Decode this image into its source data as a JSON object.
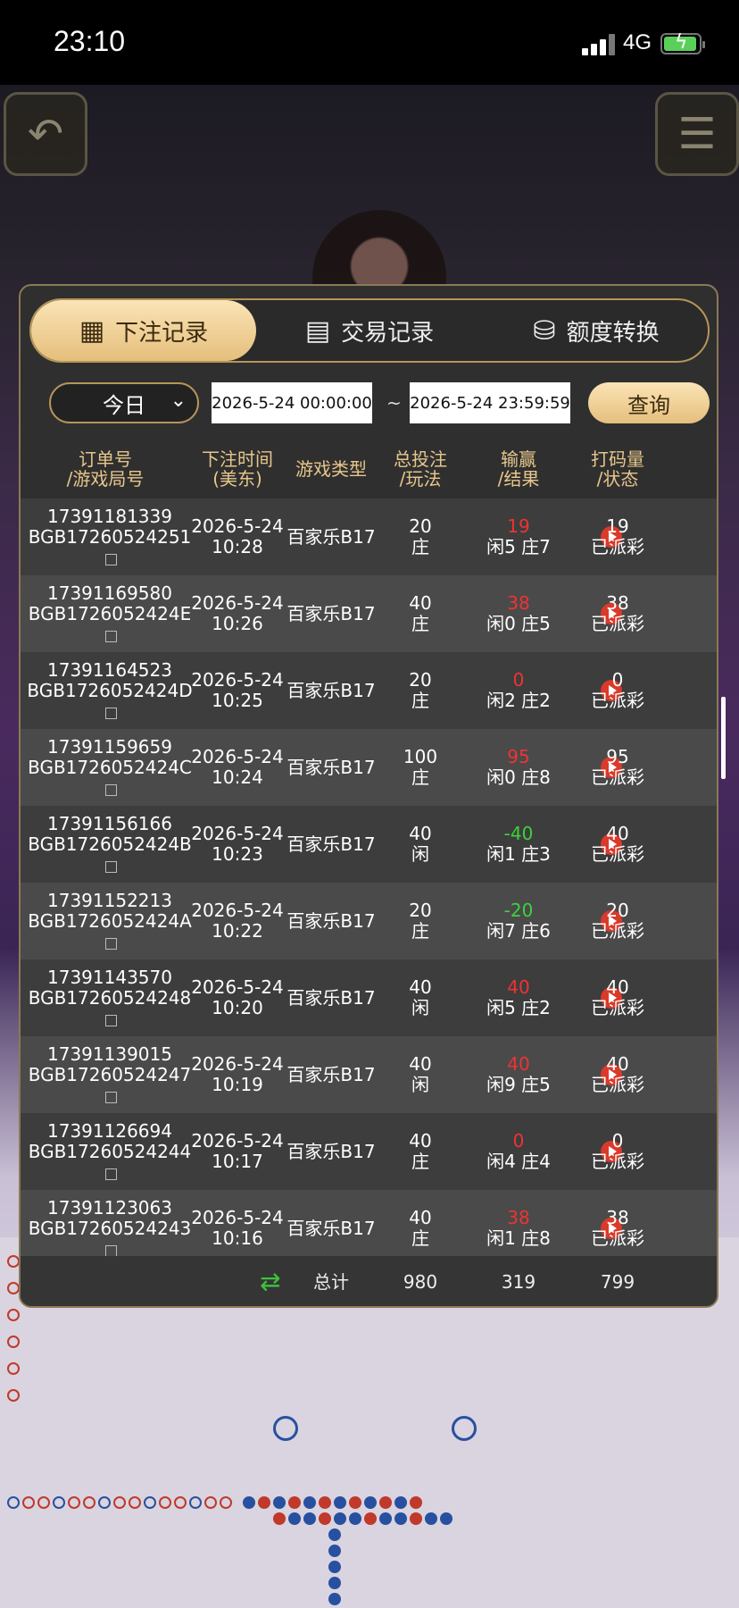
{
  "status_bar": {
    "time": "23:10",
    "network": "4G"
  },
  "tabs": [
    {
      "label": "下注记录",
      "icon": "calendar-icon",
      "active": true
    },
    {
      "label": "交易记录",
      "icon": "clipboard-icon",
      "active": false
    },
    {
      "label": "额度转换",
      "icon": "coins-icon",
      "active": false
    }
  ],
  "filter": {
    "day": "今日",
    "start": "2026-5-24 00:00:00",
    "separator": "~",
    "end": "2026-5-24 23:59:59",
    "query_label": "查询"
  },
  "columns": [
    {
      "l1": "订单号",
      "l2": "/游戏局号"
    },
    {
      "l1": "下注时间",
      "l2": "(美东)"
    },
    {
      "l1": "游戏类型",
      "l2": ""
    },
    {
      "l1": "总投注",
      "l2": "/玩法"
    },
    {
      "l1": "输赢",
      "l2": "/结果"
    },
    {
      "l1": "打码量",
      "l2": "/状态"
    }
  ],
  "rows": [
    {
      "order": "17391181339",
      "round": "BGB17260524251",
      "date": "2026-5-24",
      "time": "10:28",
      "game": "百家乐B17",
      "bet": "20",
      "play": "庄",
      "winloss": "19",
      "result": "闲5 庄7",
      "turnover": "19",
      "status": "已派彩"
    },
    {
      "order": "17391169580",
      "round": "BGB1726052424E",
      "date": "2026-5-24",
      "time": "10:26",
      "game": "百家乐B17",
      "bet": "40",
      "play": "庄",
      "winloss": "38",
      "result": "闲0 庄5",
      "turnover": "38",
      "status": "已派彩"
    },
    {
      "order": "17391164523",
      "round": "BGB1726052424D",
      "date": "2026-5-24",
      "time": "10:25",
      "game": "百家乐B17",
      "bet": "20",
      "play": "庄",
      "winloss": "0",
      "result": "闲2 庄2",
      "turnover": "0",
      "status": "已派彩"
    },
    {
      "order": "17391159659",
      "round": "BGB1726052424C",
      "date": "2026-5-24",
      "time": "10:24",
      "game": "百家乐B17",
      "bet": "100",
      "play": "庄",
      "winloss": "95",
      "result": "闲0 庄8",
      "turnover": "95",
      "status": "已派彩"
    },
    {
      "order": "17391156166",
      "round": "BGB1726052424B",
      "date": "2026-5-24",
      "time": "10:23",
      "game": "百家乐B17",
      "bet": "40",
      "play": "闲",
      "winloss": "-40",
      "result": "闲1 庄3",
      "turnover": "40",
      "status": "已派彩"
    },
    {
      "order": "17391152213",
      "round": "BGB1726052424A",
      "date": "2026-5-24",
      "time": "10:22",
      "game": "百家乐B17",
      "bet": "20",
      "play": "庄",
      "winloss": "-20",
      "result": "闲7 庄6",
      "turnover": "20",
      "status": "已派彩"
    },
    {
      "order": "17391143570",
      "round": "BGB17260524248",
      "date": "2026-5-24",
      "time": "10:20",
      "game": "百家乐B17",
      "bet": "40",
      "play": "闲",
      "winloss": "40",
      "result": "闲5 庄2",
      "turnover": "40",
      "status": "已派彩"
    },
    {
      "order": "17391139015",
      "round": "BGB17260524247",
      "date": "2026-5-24",
      "time": "10:19",
      "game": "百家乐B17",
      "bet": "40",
      "play": "闲",
      "winloss": "40",
      "result": "闲9 庄5",
      "turnover": "40",
      "status": "已派彩"
    },
    {
      "order": "17391126694",
      "round": "BGB17260524244",
      "date": "2026-5-24",
      "time": "10:17",
      "game": "百家乐B17",
      "bet": "40",
      "play": "庄",
      "winloss": "0",
      "result": "闲4 庄4",
      "turnover": "0",
      "status": "已派彩"
    },
    {
      "order": "17391123063",
      "round": "BGB17260524243",
      "date": "2026-5-24",
      "time": "10:16",
      "game": "百家乐B17",
      "bet": "40",
      "play": "庄",
      "winloss": "38",
      "result": "闲1 庄8",
      "turnover": "38",
      "status": "已派彩"
    }
  ],
  "total": {
    "label": "总计",
    "bet": "980",
    "winloss": "319",
    "turnover": "799"
  },
  "colors": {
    "gold": "#e5bf7c",
    "win": "#e33333",
    "loss": "#3cd23c"
  }
}
